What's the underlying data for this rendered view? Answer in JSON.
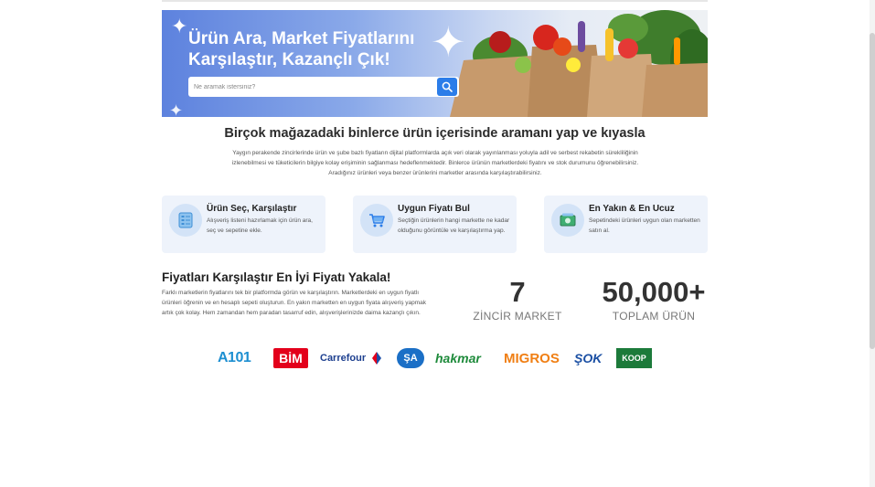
{
  "hero": {
    "title": "Ürün Ara, Market Fiyatlarını Karşılaştır, Kazançlı Çık!",
    "search_placeholder": "Ne aramak istersiniz?",
    "search_icon": "search-icon"
  },
  "headline": "Birçok mağazadaki binlerce ürün içerisinde aramanı yap ve kıyasla",
  "intro": "Yaygın perakende zincirlerinde ürün ve şube bazlı fiyatların dijital platformlarda açık veri olarak yayınlanması yoluyla adil ve serbest rekabetin sürekliliğinin izlenebilmesi ve tüketicilerin bilgiye kolay erişiminin sağlanması hedeflenmektedir. Binlerce ürünün marketlerdeki fiyatını ve stok durumunu öğrenebilirsiniz. Aradığınız ürünleri veya benzer ürünlerini marketler arasında karşılaştırabilirsiniz.",
  "features": [
    {
      "title": "Ürün Seç, Karşılaştır",
      "desc": "Alışveriş listeni hazırlamak için ürün ara, seç ve sepetine ekle.",
      "icon": "list-icon"
    },
    {
      "title": "Uygun Fiyatı Bul",
      "desc": "Seçtiğin ürünlerin hangi markette ne kadar olduğunu görüntüle ve karşılaştırma yap.",
      "icon": "cart-icon"
    },
    {
      "title": "En Yakın & En Ucuz",
      "desc": "Sepetindeki ürünleri uygun olan marketten satın al.",
      "icon": "money-icon"
    }
  ],
  "compare": {
    "title": "Fiyatları Karşılaştır En İyi Fiyatı Yakala!",
    "text": "Farklı marketlerin fiyatlarını tek bir platformda görün ve karşılaştırın. Marketlerdeki en uygun fiyatlı ürünleri öğrenin ve en hesaplı sepeti oluşturun. En yakın marketten en uygun fiyata alışveriş yapmak artık çok kolay. Hem zamandan hem paradan tasarruf edin, alışverişlerinizde daima kazançlı çıkın."
  },
  "stats": [
    {
      "value": "7",
      "label": "ZİNCİR MARKET"
    },
    {
      "value": "50,000+",
      "label": "TOPLAM ÜRÜN"
    }
  ],
  "logos": [
    "A101",
    "BİM",
    "Carrefour",
    "ŞA",
    "hakmar",
    "MIGROS",
    "ŞOK",
    "KOOP"
  ],
  "colors": {
    "accent": "#2b7de9",
    "feature_bg": "#eef3fb"
  }
}
